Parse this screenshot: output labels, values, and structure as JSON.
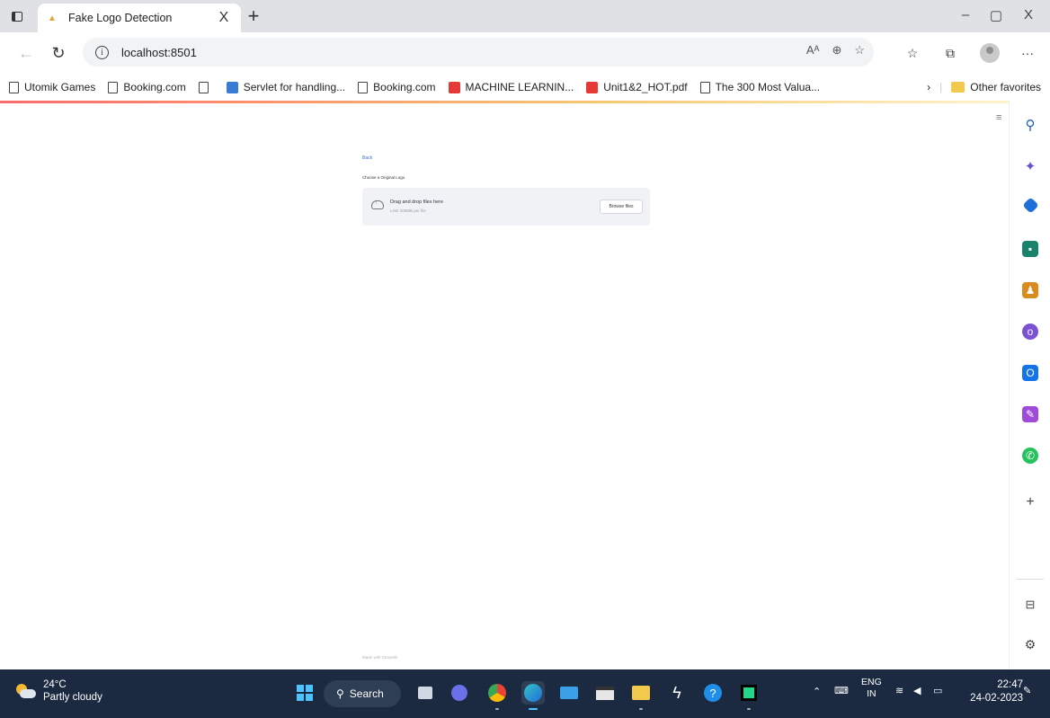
{
  "browser": {
    "tab_title": "Fake Logo Detection",
    "tab_close": "X",
    "new_tab": "+",
    "window_controls": {
      "minimize": "–",
      "maximize": "▢",
      "close": "X"
    },
    "url": "localhost:8501",
    "bookmarks": [
      {
        "label": "Utomik Games",
        "icon": "page-icon"
      },
      {
        "label": "Booking.com",
        "icon": "page-icon"
      },
      {
        "label": "",
        "icon": "page-icon"
      },
      {
        "label": "Servlet for handling...",
        "icon": "servlet-icon"
      },
      {
        "label": "Booking.com",
        "icon": "page-icon"
      },
      {
        "label": "MACHINE LEARNIN...",
        "icon": "pdf-icon"
      },
      {
        "label": "Unit1&2_HOT.pdf",
        "icon": "pdf-icon"
      },
      {
        "label": "The 300 Most Valua...",
        "icon": "page-icon"
      }
    ],
    "other_favorites": "Other favorites"
  },
  "app": {
    "back_link": "Back",
    "upload_label": "Choose a Original Logo",
    "dropzone_title": "Drag and drop files here",
    "dropzone_subtitle": "Limit 200MB per file",
    "browse_button": "Browse files",
    "footer": "Made with Streamlit",
    "menu_icon": "≡"
  },
  "sidebar_icons": [
    "search-icon",
    "copilot-icon",
    "tag-icon",
    "shopping-icon",
    "games-icon",
    "office-icon",
    "outlook-icon",
    "designer-icon",
    "whatsapp-icon",
    "add-icon",
    "split-screen-icon",
    "settings-icon"
  ],
  "taskbar": {
    "weather_temp": "24°C",
    "weather_desc": "Partly cloudy",
    "search_label": "Search",
    "lang_top": "ENG",
    "lang_bottom": "IN",
    "time": "22:47",
    "date": "24-02-2023"
  }
}
